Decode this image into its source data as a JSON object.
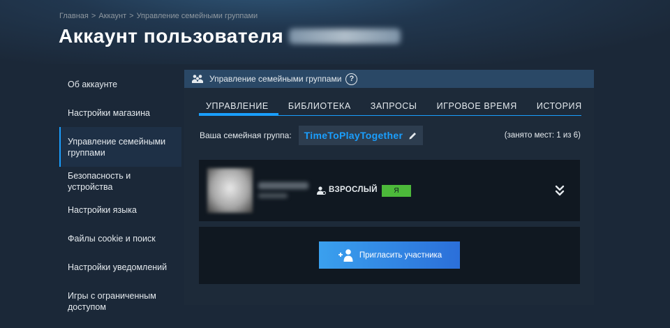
{
  "breadcrumb": [
    "Главная",
    "Аккаунт",
    "Управление семейными группами"
  ],
  "breadcrumb_separator": ">",
  "page": {
    "title": "Аккаунт пользователя"
  },
  "sidebar": {
    "items": [
      {
        "label": "Об аккаунте"
      },
      {
        "label": "Настройки магазина"
      },
      {
        "label": "Управление семейными группами",
        "active": true
      },
      {
        "label": "Безопасность и устройства"
      },
      {
        "label": "Настройки языка"
      },
      {
        "label": "Файлы cookie и поиск"
      },
      {
        "label": "Настройки уведомлений"
      },
      {
        "label": "Игры с ограниченным доступом"
      }
    ]
  },
  "panel": {
    "header_title": "Управление семейными группами",
    "help_icon_glyph": "?",
    "tabs": [
      {
        "label": "УПРАВЛЕНИЕ",
        "active": true
      },
      {
        "label": "БИБЛИОТЕКА"
      },
      {
        "label": "ЗАПРОСЫ"
      },
      {
        "label": "ИГРОВОЕ ВРЕМЯ"
      },
      {
        "label": "ИСТОРИЯ"
      }
    ],
    "group_label": "Ваша семейная группа:",
    "group_name": "TimeToPlayTogether",
    "slots": "(занято мест: 1 из 6)"
  },
  "member": {
    "role": "ВЗРОСЛЫЙ",
    "you_badge": "Я"
  },
  "invite": {
    "button_label": "Пригласить участника"
  },
  "icons": {
    "header": "family-people-icon",
    "help": "question-circle-icon",
    "edit": "pencil-icon",
    "role": "adult-person-icon",
    "expand": "double-chevron-down-icon",
    "invite": "add-user-icon"
  },
  "colors": {
    "accent": "#1a9fff",
    "background": "#1b2838",
    "panel_header": "#2a4866",
    "badge_green": "#4cb93a",
    "invite_gradient_start": "#3aa0ee",
    "invite_gradient_end": "#2b6fd9"
  }
}
